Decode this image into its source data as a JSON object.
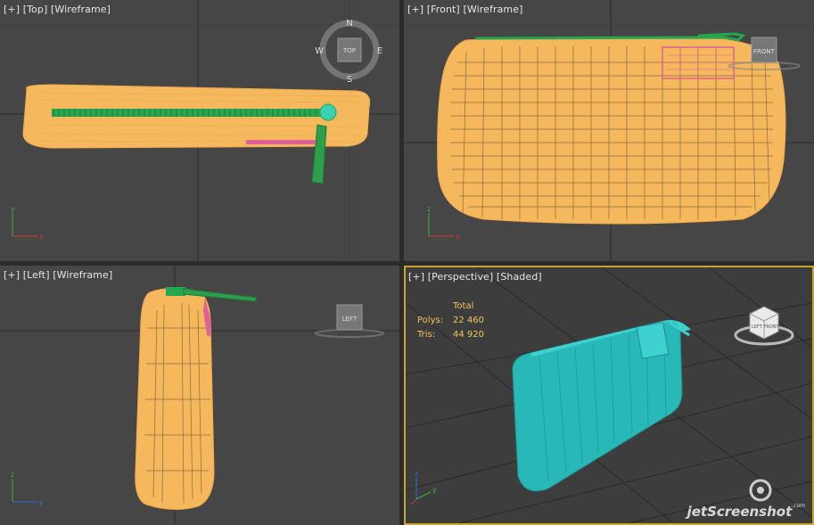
{
  "viewports": {
    "top": {
      "plus": "[+]",
      "name": "[Top]",
      "mode": "[Wireframe]",
      "nav": {
        "n": "N",
        "s": "S",
        "e": "E",
        "w": "W",
        "cube": "TOP"
      }
    },
    "front": {
      "plus": "[+]",
      "name": "[Front]",
      "mode": "[Wireframe]",
      "cube": "FRONT"
    },
    "left": {
      "plus": "[+]",
      "name": "[Left]",
      "mode": "[Wireframe]",
      "cube": "LEFT"
    },
    "perspective": {
      "plus": "[+]",
      "name": "[Perspective]",
      "mode": "[Shaded]",
      "cube_front": "FRONT",
      "cube_left": "LEFT"
    }
  },
  "stats": {
    "header": "Total",
    "polys_label": "Polys:",
    "polys_value": "22 460",
    "tris_label": "Tris:",
    "tris_value": "44 920"
  },
  "watermark": {
    "text": "jetScreenshot",
    "suffix": ".com"
  },
  "colors": {
    "viewport_bg": "#464646",
    "active_border": "#c9a433",
    "wire": "#f5b85c",
    "zipper": "#27a650",
    "pink": "#e0609a",
    "teal": "#29b8b8"
  }
}
